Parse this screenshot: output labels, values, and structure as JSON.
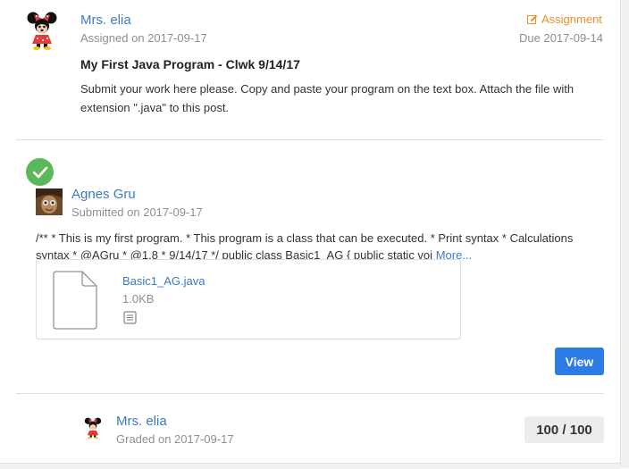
{
  "assignment": {
    "author": "Mrs. elia",
    "assigned_on": "Assigned on 2017-09-17",
    "type_label": "Assignment",
    "due": "Due 2017-09-14",
    "title": "My First Java Program - Clwk 9/14/17",
    "instructions": "Submit your work here please. Copy and paste your program on the text box. Attach the file with extension \".java\" to this post."
  },
  "submission": {
    "status_icon": "check-icon",
    "student": "Agnes Gru",
    "submitted_on": "Submitted on 2017-09-17",
    "body_line1": "/** * This is my first program. * This program is a class that can be executed. * Print syntax * Calculations",
    "body_line2": "syntax * @AGru * @1.8 * 9/14/17 */ public class Basic1_AG { public static voi",
    "more_link": "More...",
    "attachment": {
      "file_name": "Basic1_AG.java",
      "file_size": "1.0KB",
      "file_icon": "document-icon",
      "preview_icon": "text-preview-icon"
    },
    "view_button": "View"
  },
  "grade": {
    "grader": "Mrs. elia",
    "graded_on": "Graded on 2017-09-17",
    "score": "100 / 100"
  },
  "colors": {
    "link": "#3a7bc8",
    "assignment_accent": "#e8912d",
    "success": "#5cb85c",
    "primary_button": "#2d7be5"
  }
}
